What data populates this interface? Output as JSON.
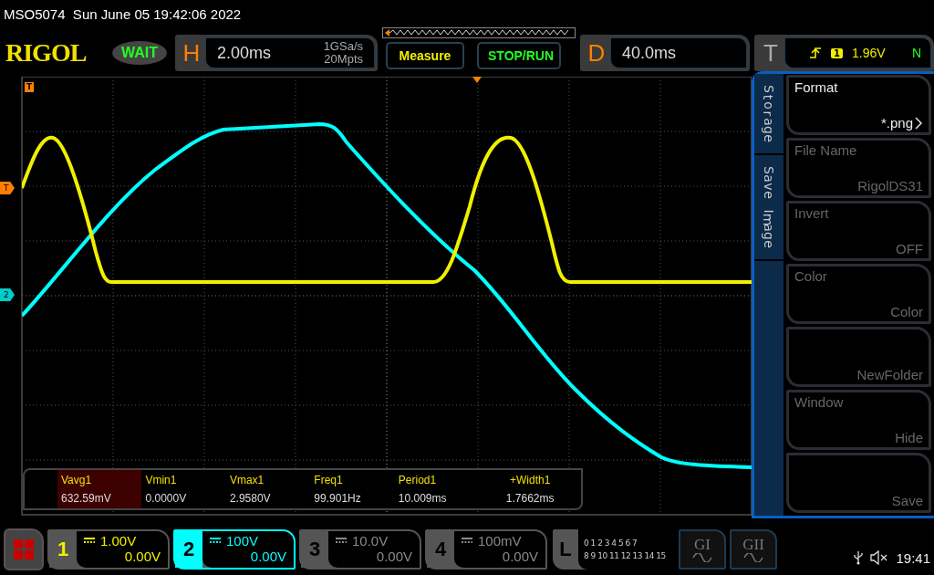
{
  "status_line": "MSO5074  Sun June 05 19:42:06 2022",
  "logo": "RIGOL",
  "run_state": "WAIT",
  "horizontal": {
    "label": "H",
    "timebase": "2.00ms",
    "sample_rate": "1GSa/s",
    "memory_depth": "20Mpts"
  },
  "buttons": [
    {
      "label": "Measure",
      "kind": "measure"
    },
    {
      "label": "STOP/RUN",
      "kind": "run"
    }
  ],
  "delay": {
    "label": "D",
    "value": "40.0ms"
  },
  "trigger": {
    "label": "T",
    "source": "1",
    "level": "1.96V",
    "mode": "N"
  },
  "trigger_position_marker": "T",
  "waveform_markers": [
    {
      "label": "T",
      "kind": "trigger_level"
    },
    {
      "label": "2",
      "kind": "channel"
    }
  ],
  "menu": {
    "tabs": [
      {
        "label": "Storage"
      },
      {
        "label": "Save Image"
      }
    ],
    "softkeys": [
      {
        "title": "Format",
        "value": "*.png",
        "submenu": true,
        "disabled": false
      },
      {
        "title": "File Name",
        "value": "RigolDS31",
        "submenu": false,
        "disabled": true
      },
      {
        "title": "Invert",
        "value": "OFF",
        "submenu": false,
        "disabled": true
      },
      {
        "title": "Color",
        "value": "Color",
        "submenu": false,
        "disabled": true
      },
      {
        "value": "NewFolder",
        "submenu": false,
        "disabled": true
      },
      {
        "title": "Window",
        "value": "Hide",
        "submenu": false,
        "disabled": true
      },
      {
        "value": "Save",
        "submenu": false,
        "disabled": true
      }
    ]
  },
  "measurements": [
    {
      "label": "Vavg1",
      "value": "632.59mV",
      "selected": true
    },
    {
      "label": "Vmin1",
      "value": "0.0000V",
      "selected": false
    },
    {
      "label": "Vmax1",
      "value": "2.9580V",
      "selected": false
    },
    {
      "label": "Freq1",
      "value": "99.901Hz",
      "selected": false
    },
    {
      "label": "Period1",
      "value": "10.009ms",
      "selected": false
    },
    {
      "label": "+Width1",
      "value": "1.7662ms",
      "selected": false
    }
  ],
  "channels": [
    {
      "number": "1",
      "scale": "1.00V",
      "offset": "0.00V",
      "color": "#f0f000",
      "on": true,
      "selected": false
    },
    {
      "number": "2",
      "scale": "100V",
      "offset": "0.00V",
      "color": "#00ffff",
      "on": true,
      "selected": true
    },
    {
      "number": "3",
      "scale": "10.0V",
      "offset": "0.00V",
      "on": false,
      "selected": false
    },
    {
      "number": "4",
      "scale": "100mV",
      "offset": "0.00V",
      "on": false,
      "selected": false
    }
  ],
  "logic": {
    "label": "L",
    "row_1": [
      "0",
      "1",
      "2",
      "3",
      "4",
      "5",
      "6",
      "7"
    ],
    "row_2": [
      "8",
      "9",
      "10",
      "11",
      "12",
      "13",
      "14",
      "15"
    ]
  },
  "generators": [
    {
      "label": "GI"
    },
    {
      "label": "GII"
    }
  ],
  "clock": "19:41"
}
